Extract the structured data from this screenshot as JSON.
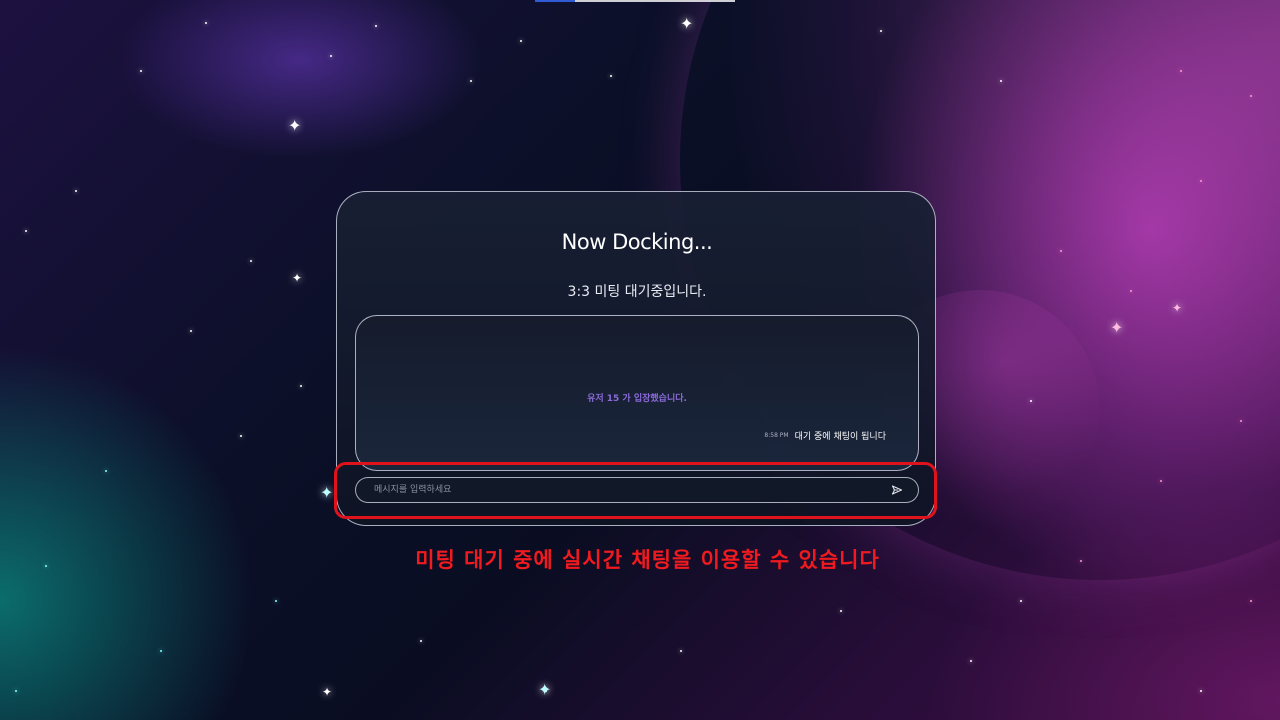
{
  "dock": {
    "title": "Now Docking...",
    "subtitle": "3:3 미팅 대기중입니다."
  },
  "chat": {
    "system_notice": "유저 15 가 입장했습니다.",
    "messages": [
      {
        "time": "8:58 PM",
        "text": "대기 중에 채팅이 됩니다"
      }
    ],
    "input_placeholder": "메시지를 입력하세요",
    "send_icon": "send-icon"
  },
  "annotation": {
    "caption": "미팅 대기 중에 실시간 채팅을 이용할 수 있습니다",
    "highlight_color": "#e0121b"
  },
  "colors": {
    "notice": "#8a6ad8",
    "caption": "#f01a1f"
  }
}
